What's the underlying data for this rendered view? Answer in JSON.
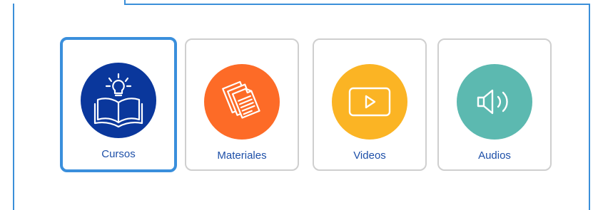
{
  "cards": [
    {
      "label": "Cursos",
      "icon": "book-lightbulb-icon",
      "color": "#0a379c",
      "selected": true
    },
    {
      "label": "Materiales",
      "icon": "documents-icon",
      "color": "#fd6b27",
      "selected": false
    },
    {
      "label": "Videos",
      "icon": "play-screen-icon",
      "color": "#fbb424",
      "selected": false
    },
    {
      "label": "Audios",
      "icon": "speaker-icon",
      "color": "#5cb9b0",
      "selected": false
    }
  ],
  "colors": {
    "frame_border": "#3b8fd9",
    "selected_border": "#3a8fdc",
    "card_border": "#cfcfcf",
    "label_text": "#1d4fa8"
  }
}
